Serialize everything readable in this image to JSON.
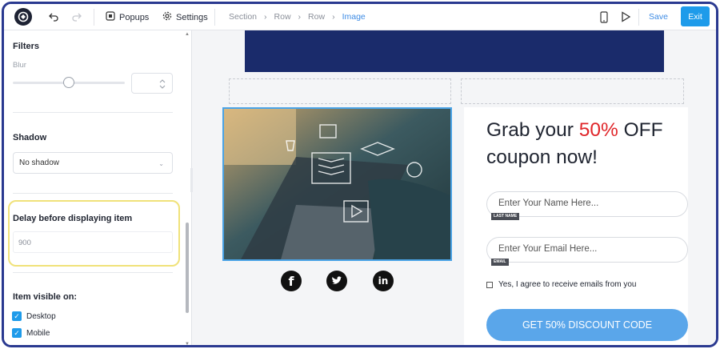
{
  "toolbar": {
    "popups_label": "Popups",
    "settings_label": "Settings",
    "breadcrumbs": [
      "Section",
      "Row",
      "Row",
      "Image"
    ],
    "save_label": "Save",
    "exit_label": "Exit",
    "accent_color": "#1e9bea"
  },
  "panel": {
    "filters_title": "Filters",
    "blur_label": "Blur",
    "shadow_title": "Shadow",
    "shadow_value": "No shadow",
    "delay_title": "Delay before displaying item",
    "delay_value": "900",
    "visible_title": "Item visible on:",
    "visible_options": [
      {
        "label": "Desktop",
        "checked": true
      },
      {
        "label": "Mobile",
        "checked": true
      }
    ]
  },
  "canvas": {
    "banner_color": "#1a2b6b",
    "headline_pre": "Grab your ",
    "headline_accent": "50%",
    "headline_post": " OFF coupon now!",
    "name_placeholder": "Enter Your Name Here...",
    "name_tag": "LAST NAME",
    "email_placeholder": "Enter Your Email Here...",
    "email_tag": "EMAIL",
    "agree_text": "Yes, I agree to receive emails from you",
    "cta_label": "GET 50% DISCOUNT CODE",
    "social": [
      "facebook-icon",
      "twitter-icon",
      "linkedin-icon"
    ]
  }
}
